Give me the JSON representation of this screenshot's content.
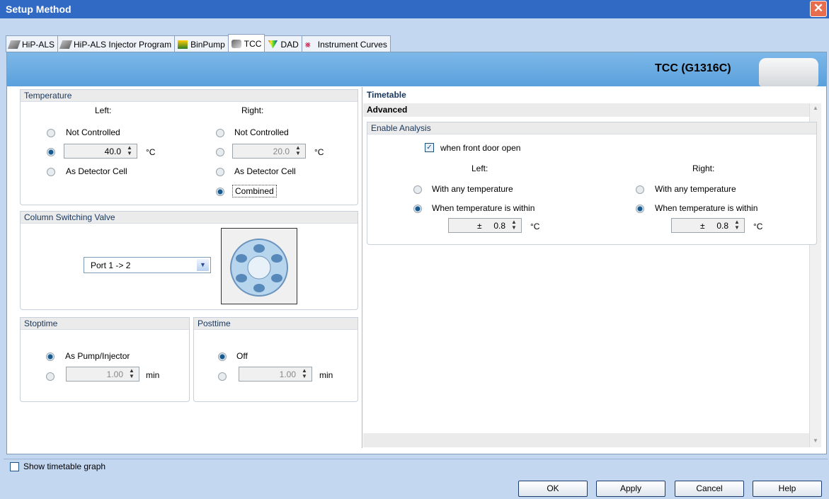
{
  "window": {
    "title": "Setup Method",
    "close_symbol": "✕"
  },
  "tabs": [
    {
      "label": "HiP-ALS",
      "icon": "module-icon"
    },
    {
      "label": "HiP-ALS Injector Program",
      "icon": "module-icon"
    },
    {
      "label": "BinPump",
      "icon": "pump-icon"
    },
    {
      "label": "TCC",
      "icon": "tcc-icon"
    },
    {
      "label": "DAD",
      "icon": "dad-icon"
    },
    {
      "label": "Instrument Curves",
      "icon": "curves-icon"
    }
  ],
  "device": {
    "name": "TCC (G1316C)"
  },
  "temperature": {
    "title": "Temperature",
    "left_label": "Left:",
    "right_label": "Right:",
    "not_controlled": "Not Controlled",
    "as_detector": "As Detector Cell",
    "combined": "Combined",
    "left_value": "40.0",
    "right_value": "20.0",
    "unit": "°C"
  },
  "valve": {
    "title": "Column Switching Valve",
    "selected": "Port 1 -> 2"
  },
  "stoptime": {
    "title": "Stoptime",
    "option1": "As Pump/Injector",
    "value": "1.00",
    "unit": "min"
  },
  "posttime": {
    "title": "Posttime",
    "option1": "Off",
    "value": "1.00",
    "unit": "min"
  },
  "right_panel": {
    "timetable": "Timetable",
    "advanced": "Advanced",
    "enable_analysis": "Enable Analysis",
    "front_door": "when front door open",
    "left_label": "Left:",
    "right_label": "Right:",
    "any_temp": "With any temperature",
    "within": "When temperature is within",
    "pm": "±",
    "left_tol": "0.8",
    "right_tol": "0.8",
    "unit": "°C"
  },
  "footer": {
    "show_graph": "Show timetable graph",
    "ok": "OK",
    "apply": "Apply",
    "cancel": "Cancel",
    "help": "Help"
  }
}
